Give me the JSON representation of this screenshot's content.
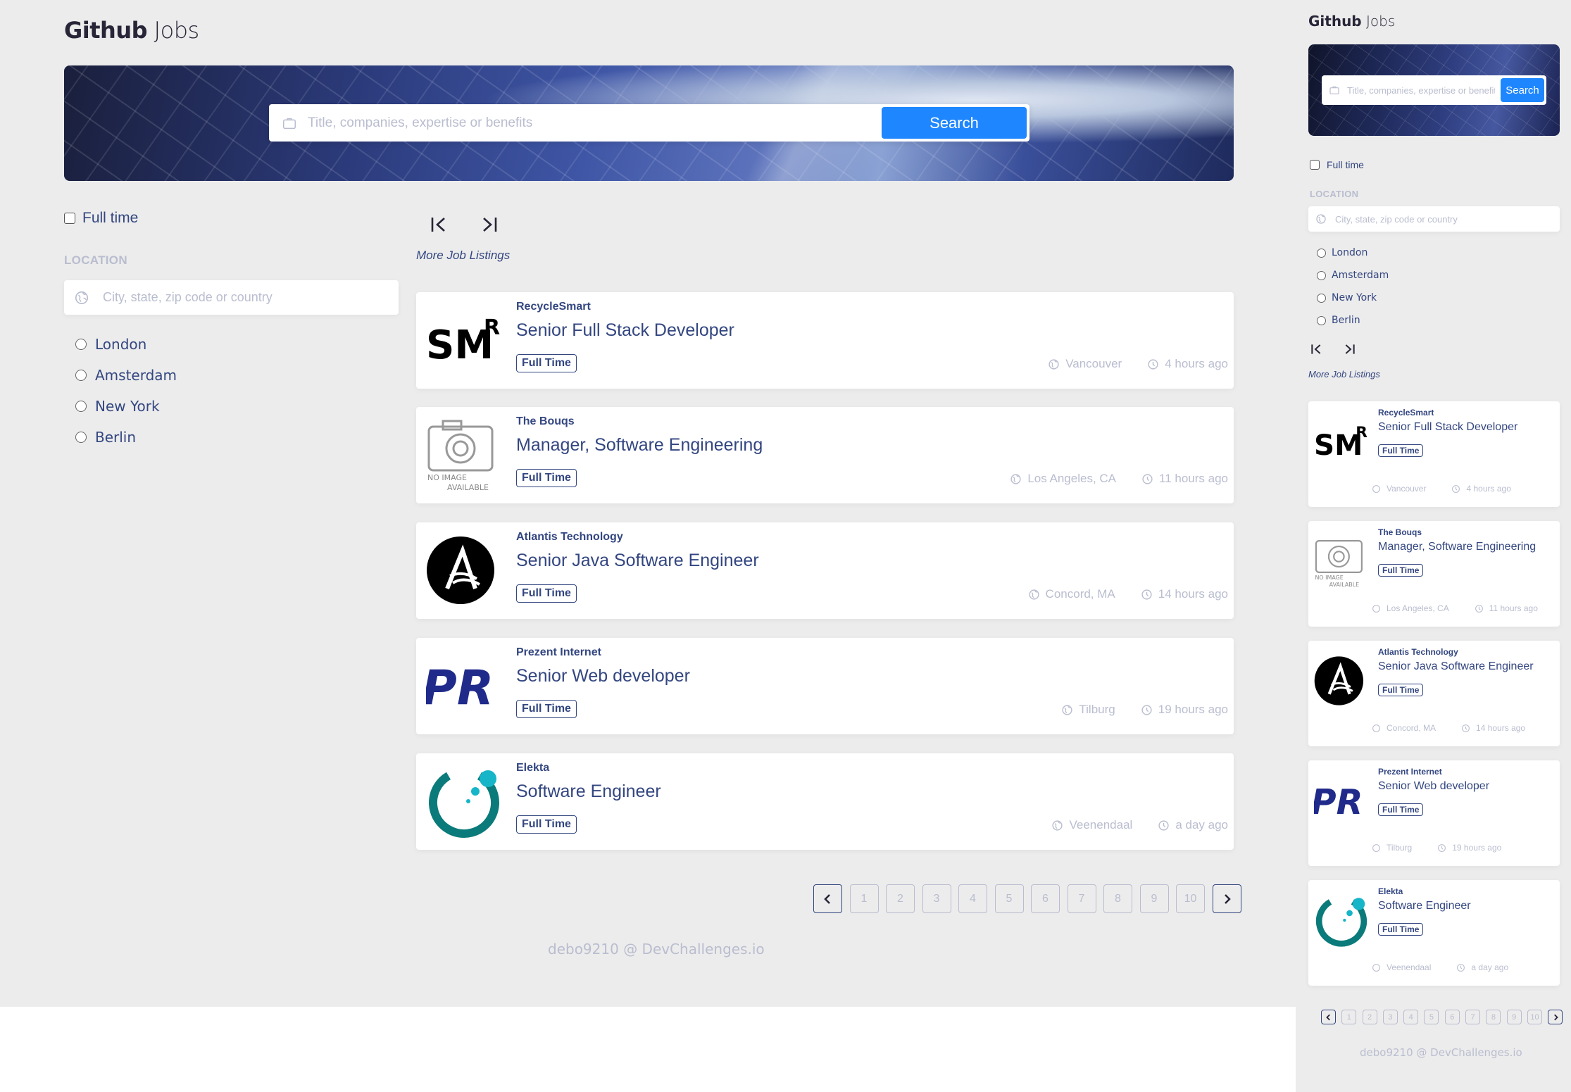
{
  "app": {
    "title_bold": "Github",
    "title_light": "Jobs"
  },
  "search": {
    "placeholder": "Title, companies, expertise or benefits",
    "button": "Search"
  },
  "filters": {
    "full_time_label": "Full time",
    "location_heading": "LOCATION",
    "location_placeholder": "City, state, zip code or country",
    "locations": [
      "London",
      "Amsterdam",
      "New York",
      "Berlin"
    ]
  },
  "more_listings": "More Job Listings",
  "jobs": [
    {
      "company": "RecycleSmart",
      "title": "Senior Full Stack Developer",
      "type": "Full Time",
      "location": "Vancouver",
      "posted": "4 hours ago",
      "logo": "recyclesmart-logo"
    },
    {
      "company": "The Bouqs",
      "title": "Manager, Software Engineering",
      "type": "Full Time",
      "location": "Los Angeles, CA",
      "posted": "11 hours ago",
      "logo": "no-image-available"
    },
    {
      "company": "Atlantis Technology",
      "title": "Senior Java Software Engineer",
      "type": "Full Time",
      "location": "Concord, MA",
      "posted": "14 hours ago",
      "logo": "atlantis-logo"
    },
    {
      "company": "Prezent Internet",
      "title": "Senior Web developer",
      "type": "Full Time",
      "location": "Tilburg",
      "posted": "19 hours ago",
      "logo": "prezent-logo"
    },
    {
      "company": "Elekta",
      "title": "Software Engineer",
      "type": "Full Time",
      "location": "Veenendaal",
      "posted": "a day ago",
      "logo": "elekta-logo"
    }
  ],
  "pagination": {
    "pages": [
      "1",
      "2",
      "3",
      "4",
      "5",
      "6",
      "7",
      "8",
      "9",
      "10"
    ]
  },
  "footer": "debo9210 @ DevChallenges.io",
  "logo_text": {
    "recyclesmart_big": "SM",
    "recyclesmart_r": "R",
    "prezent": "PR",
    "no_image_1": "NO IMAGE",
    "no_image_2": "AVAILABLE"
  },
  "colors": {
    "accent": "#1e86ff",
    "text": "#334680",
    "muted": "#b9bdcf",
    "background": "#ececec"
  }
}
